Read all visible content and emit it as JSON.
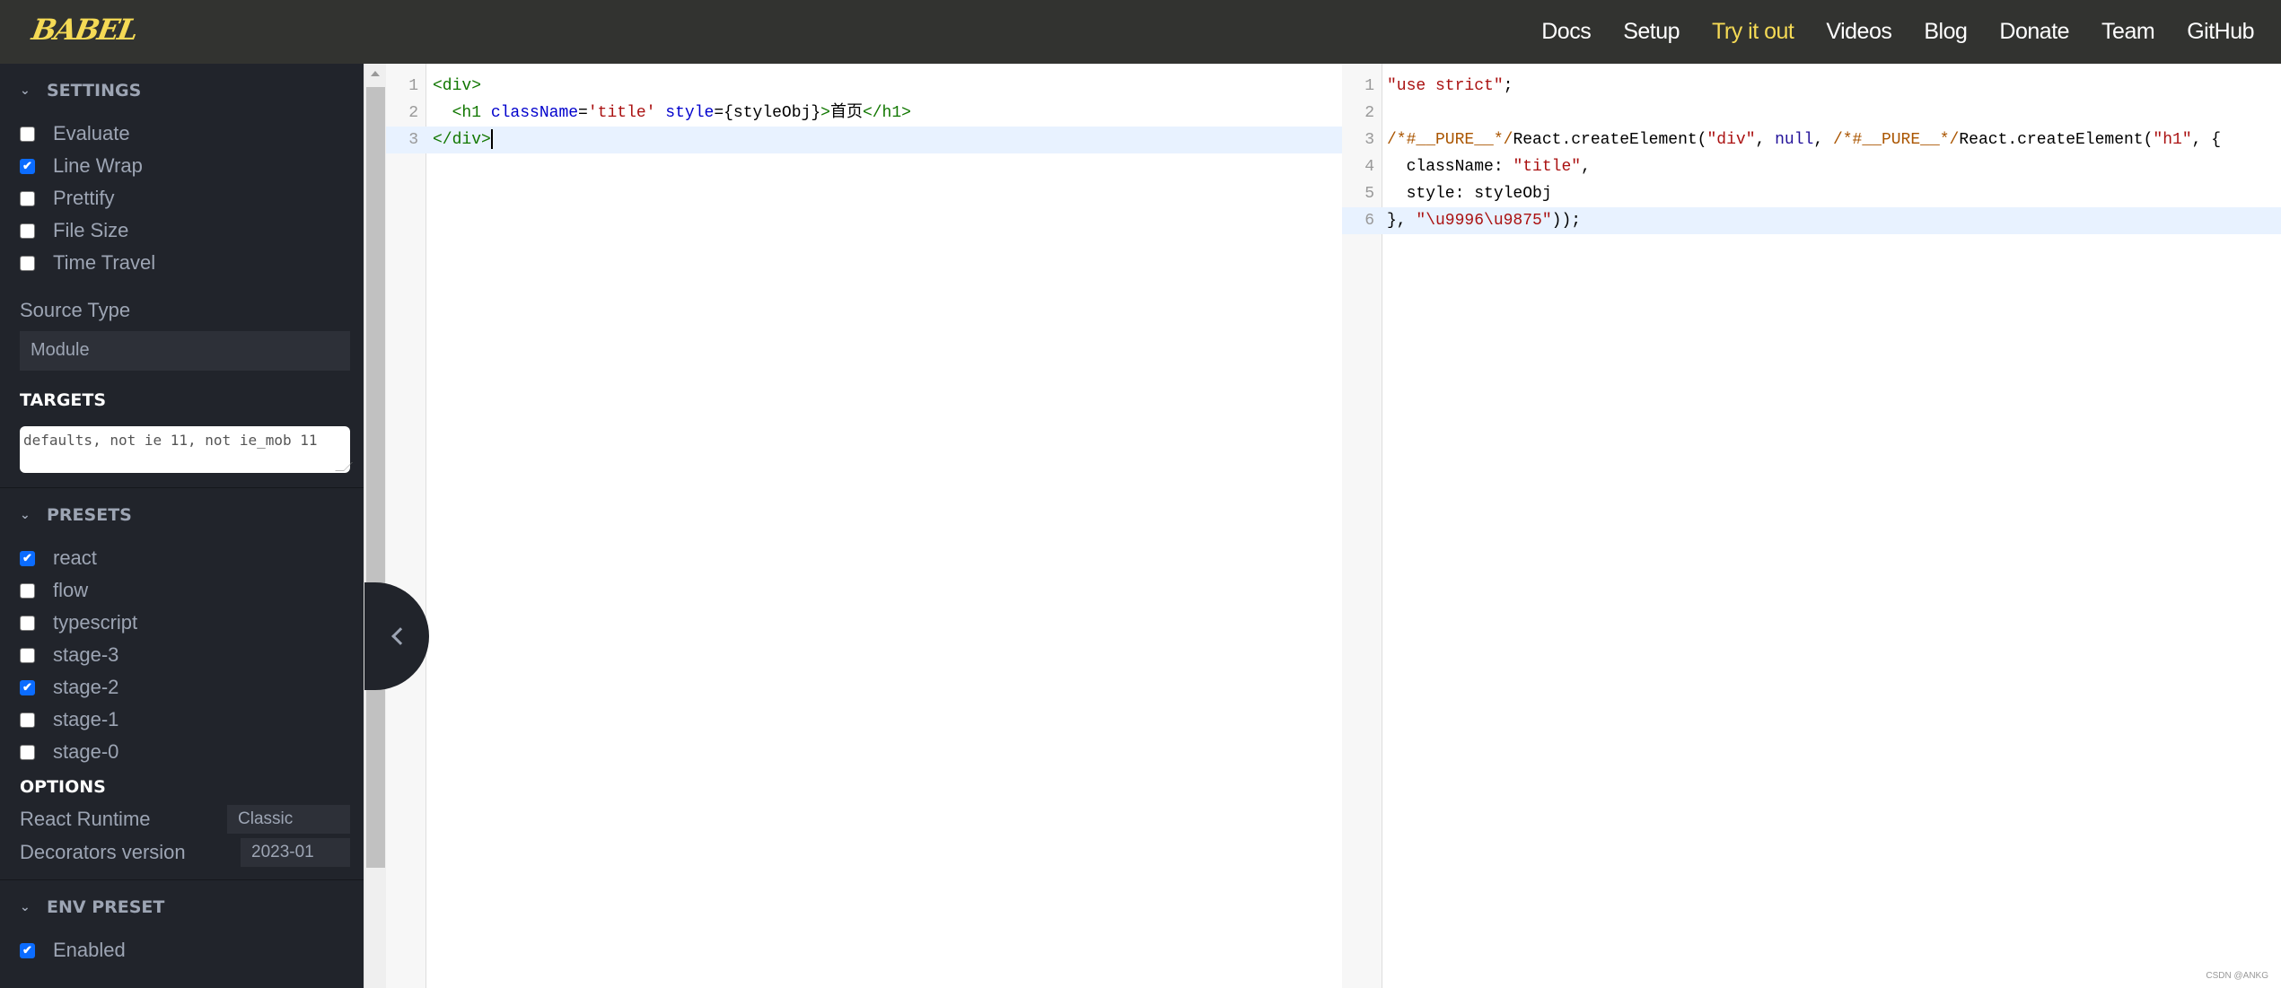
{
  "header": {
    "logo": "BABEL",
    "nav": [
      "Docs",
      "Setup",
      "Try it out",
      "Videos",
      "Blog",
      "Donate",
      "Team",
      "GitHub"
    ],
    "active_nav": "Try it out",
    "accent_color": "#f5da55"
  },
  "sidebar": {
    "settings": {
      "title": "SETTINGS",
      "items": [
        {
          "label": "Evaluate",
          "checked": false
        },
        {
          "label": "Line Wrap",
          "checked": true
        },
        {
          "label": "Prettify",
          "checked": false
        },
        {
          "label": "File Size",
          "checked": false
        },
        {
          "label": "Time Travel",
          "checked": false
        }
      ],
      "source_type_label": "Source Type",
      "source_type_value": "Module",
      "targets_label": "TARGETS",
      "targets_value": "defaults, not ie 11, not ie_mob 11"
    },
    "presets": {
      "title": "PRESETS",
      "items": [
        {
          "label": "react",
          "checked": true
        },
        {
          "label": "flow",
          "checked": false
        },
        {
          "label": "typescript",
          "checked": false
        },
        {
          "label": "stage-3",
          "checked": false
        },
        {
          "label": "stage-2",
          "checked": true
        },
        {
          "label": "stage-1",
          "checked": false
        },
        {
          "label": "stage-0",
          "checked": false
        }
      ]
    },
    "options": {
      "title": "OPTIONS",
      "react_runtime_label": "React Runtime",
      "react_runtime_value": "Classic",
      "decorators_label": "Decorators version",
      "decorators_value": "2023-01"
    },
    "env_preset": {
      "title": "ENV PRESET",
      "enabled_label": "Enabled",
      "enabled_checked": true
    }
  },
  "input_editor": {
    "line_numbers": [
      "1",
      "2",
      "3"
    ],
    "current_line": 3,
    "lines": [
      [
        {
          "t": "tag",
          "v": "<div>"
        }
      ],
      [
        {
          "t": "def",
          "v": "  "
        },
        {
          "t": "tag",
          "v": "<h1 "
        },
        {
          "t": "attr",
          "v": "className"
        },
        {
          "t": "def",
          "v": "="
        },
        {
          "t": "str",
          "v": "'title'"
        },
        {
          "t": "def",
          "v": " "
        },
        {
          "t": "attr",
          "v": "style"
        },
        {
          "t": "def",
          "v": "={styleObj}"
        },
        {
          "t": "tag",
          "v": ">"
        },
        {
          "t": "def",
          "v": "首页"
        },
        {
          "t": "tag",
          "v": "</h1>"
        }
      ],
      [
        {
          "t": "tag",
          "v": "</div>"
        }
      ]
    ]
  },
  "output_editor": {
    "line_numbers": [
      "1",
      "2",
      "3",
      "4",
      "5",
      "6"
    ],
    "current_line": 6,
    "lines": [
      [
        {
          "t": "str",
          "v": "\"use strict\""
        },
        {
          "t": "def",
          "v": ";"
        }
      ],
      [],
      [
        {
          "t": "com",
          "v": "/*#__PURE__*/"
        },
        {
          "t": "def",
          "v": "React.createElement("
        },
        {
          "t": "str",
          "v": "\"div\""
        },
        {
          "t": "def",
          "v": ", "
        },
        {
          "t": "kw",
          "v": "null"
        },
        {
          "t": "def",
          "v": ", "
        },
        {
          "t": "com",
          "v": "/*#__PURE__*/"
        },
        {
          "t": "def",
          "v": "React.createElement("
        },
        {
          "t": "str",
          "v": "\"h1\""
        },
        {
          "t": "def",
          "v": ", {"
        }
      ],
      [
        {
          "t": "def",
          "v": "  className: "
        },
        {
          "t": "str",
          "v": "\"title\""
        },
        {
          "t": "def",
          "v": ","
        }
      ],
      [
        {
          "t": "def",
          "v": "  style: styleObj"
        }
      ],
      [
        {
          "t": "def",
          "v": "}, "
        },
        {
          "t": "str",
          "v": "\"\\u9996\\u9875\""
        },
        {
          "t": "def",
          "v": "));"
        }
      ]
    ]
  },
  "watermark": "CSDN @ANKG"
}
